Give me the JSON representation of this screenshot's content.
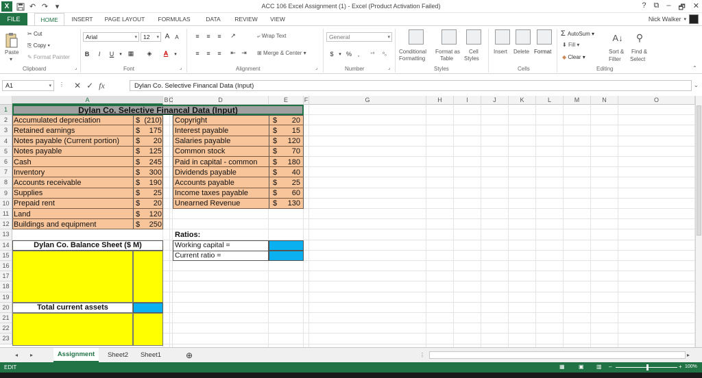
{
  "window": {
    "title": "ACC 106 Excel Assignment (1) - Excel (Product Activation Failed)",
    "controls": [
      "?",
      "⧉",
      "–",
      "🗗",
      "✕"
    ]
  },
  "quick_access": [
    "save-icon",
    "undo-icon",
    "redo-icon",
    "customize-icon"
  ],
  "ribbon_tabs": [
    "FILE",
    "HOME",
    "INSERT",
    "PAGE LAYOUT",
    "FORMULAS",
    "DATA",
    "REVIEW",
    "VIEW"
  ],
  "active_tab": "HOME",
  "user": "Nick Walker",
  "clipboard": {
    "cut": "Cut",
    "copy": "Copy",
    "paste": "Paste",
    "format_painter": "Format Painter",
    "group": "Clipboard"
  },
  "font": {
    "name": "Arial",
    "size": "12",
    "grow": "A",
    "shrink": "A",
    "bold": "B",
    "italic": "I",
    "underline": "U",
    "color_a": "A",
    "group": "Font"
  },
  "alignment": {
    "wrap": "Wrap Text",
    "merge": "Merge & Center",
    "group": "Alignment"
  },
  "number": {
    "format": "General",
    "currency": "$",
    "percent": "%",
    "comma": ",",
    "group": "Number"
  },
  "styles": {
    "conditional": "Conditional",
    "conditional2": "Formatting",
    "format_as": "Format as",
    "format_as2": "Table",
    "cell": "Cell",
    "cell2": "Styles",
    "group": "Styles"
  },
  "cells": {
    "insert": "Insert",
    "delete": "Delete",
    "format": "Format",
    "group": "Cells"
  },
  "editing": {
    "autosum": "AutoSum",
    "fill": "Fill",
    "clear": "Clear",
    "sort": "Sort &",
    "sort2": "Filter",
    "find": "Find &",
    "find2": "Select",
    "group": "Editing"
  },
  "formula_bar": {
    "name_box": "A1",
    "formula": "Dylan Co. Selective Financal Data (Input)",
    "fx": "fx"
  },
  "columns": [
    "A",
    "B",
    "C",
    "D",
    "E",
    "F",
    "G",
    "H",
    "I",
    "J",
    "K",
    "L",
    "M",
    "N",
    "O"
  ],
  "rows": [
    "1",
    "2",
    "3",
    "4",
    "5",
    "6",
    "7",
    "8",
    "9",
    "10",
    "11",
    "12",
    "13",
    "14",
    "15",
    "16",
    "17",
    "18",
    "19",
    "20",
    "21",
    "22",
    "23"
  ],
  "sheet": {
    "title": "Dylan Co. Selective Financal Data (Input)",
    "left_items": [
      {
        "label": "Accumulated depreciation",
        "sign": "$",
        "amount": "(210)"
      },
      {
        "label": "Retained earnings",
        "sign": "$",
        "amount": "175"
      },
      {
        "label": "Notes payable (Current portion)",
        "sign": "$",
        "amount": "20"
      },
      {
        "label": "Notes payable",
        "sign": "$",
        "amount": "125"
      },
      {
        "label": "Cash",
        "sign": "$",
        "amount": "245"
      },
      {
        "label": "Inventory",
        "sign": "$",
        "amount": "300"
      },
      {
        "label": "Accounts receivable",
        "sign": "$",
        "amount": "190"
      },
      {
        "label": "Supplies",
        "sign": "$",
        "amount": "25"
      },
      {
        "label": "Prepaid rent",
        "sign": "$",
        "amount": "20"
      },
      {
        "label": "Land",
        "sign": "$",
        "amount": "120"
      },
      {
        "label": "Buildings and equipment",
        "sign": "$",
        "amount": "250"
      }
    ],
    "right_items": [
      {
        "label": "Copyright",
        "sign": "$",
        "amount": "20"
      },
      {
        "label": "Interest payable",
        "sign": "$",
        "amount": "15"
      },
      {
        "label": "Salaries payable",
        "sign": "$",
        "amount": "120"
      },
      {
        "label": "Common stock",
        "sign": "$",
        "amount": "70"
      },
      {
        "label": "Paid in capital - common",
        "sign": "$",
        "amount": "180"
      },
      {
        "label": "Dividends payable",
        "sign": "$",
        "amount": "40"
      },
      {
        "label": "Accounts payable",
        "sign": "$",
        "amount": "25"
      },
      {
        "label": "Income taxes payable",
        "sign": "$",
        "amount": "60"
      },
      {
        "label": "Unearned Revenue",
        "sign": "$",
        "amount": "130"
      }
    ],
    "ratios": {
      "title": "Ratios:",
      "working_capital": "Working capital =",
      "current_ratio": "Current ratio ="
    },
    "balance_sheet_title": "Dylan Co. Balance Sheet ($ M)",
    "total_current_assets": "Total current assets"
  },
  "colors": {
    "peach": "#f8c49a",
    "yellow": "#ffff00",
    "blue": "#0ab0f0",
    "excel_green": "#217346"
  },
  "sheet_tabs": [
    "Assignment",
    "Sheet2",
    "Sheet1"
  ],
  "active_sheet": "Assignment",
  "status": {
    "mode": "EDIT",
    "zoom": "100%"
  }
}
